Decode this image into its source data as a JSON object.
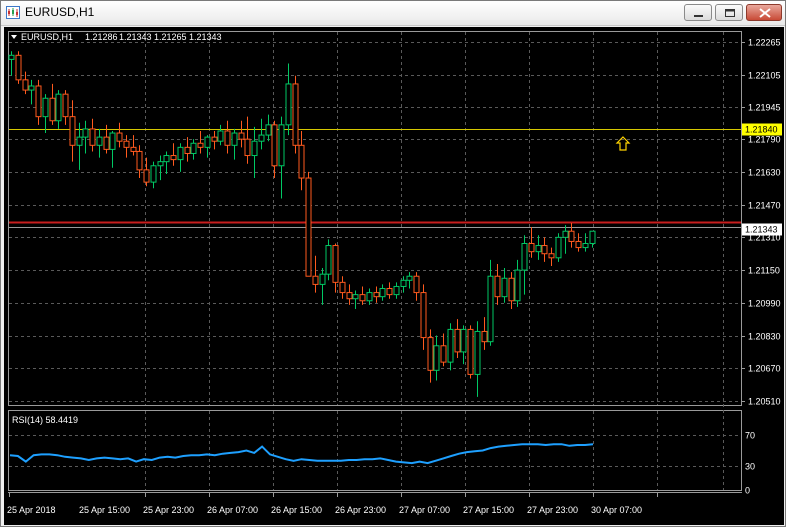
{
  "window": {
    "title": "EURUSD,H1"
  },
  "header": {
    "symbol": "EURUSD,H1",
    "open": "1.21286",
    "high": "1.21343",
    "low": "1.21265",
    "close": "1.21343"
  },
  "price_axis": {
    "labels": [
      "1.22265",
      "1.22105",
      "1.21945",
      "1.21790",
      "1.21630",
      "1.21470",
      "1.21310",
      "1.21150",
      "1.20990",
      "1.20830",
      "1.20670",
      "1.20510"
    ],
    "ask_line_label": "1.21840",
    "bid_line_label": "1.21343"
  },
  "time_axis": {
    "labels": [
      "25 Apr 2018",
      "25 Apr 15:00",
      "25 Apr 23:00",
      "26 Apr 07:00",
      "26 Apr 15:00",
      "26 Apr 23:00",
      "27 Apr 07:00",
      "27 Apr 15:00",
      "27 Apr 23:00",
      "30 Apr 07:00"
    ]
  },
  "rsi": {
    "label": "RSI(14) 58.4419",
    "levels": [
      "70",
      "30",
      "0"
    ],
    "level_values": [
      70,
      30,
      0
    ]
  },
  "colors": {
    "background": "#000000",
    "grid": "#5a5a5a",
    "bull_candle": "#00c864",
    "bear_candle": "#ff5a1e",
    "yellow_line": "#d6c800",
    "red_line": "#c81e1e",
    "rsi_line": "#1ea0ff"
  },
  "icons": {
    "arrow_marker": "up-arrow-icon",
    "window_minimize": "minimize-icon",
    "window_maximize": "maximize-icon",
    "window_close": "close-icon"
  },
  "chart_data": {
    "type": "candlestick",
    "symbol": "EURUSD",
    "timeframe": "H1",
    "ylim": [
      1.2051,
      1.22265
    ],
    "horizontal_lines": [
      1.2184,
      1.2138
    ],
    "arrow_price": 1.2177,
    "series": [
      {
        "name": "EURUSD,H1",
        "candles": [
          [
            1.2218,
            1.2222,
            1.221,
            1.222
          ],
          [
            1.222,
            1.2222,
            1.2206,
            1.2208
          ],
          [
            1.2208,
            1.2212,
            1.2201,
            1.2203
          ],
          [
            1.2203,
            1.2208,
            1.2196,
            1.2205
          ],
          [
            1.2205,
            1.2208,
            1.2186,
            1.219
          ],
          [
            1.219,
            1.2201,
            1.2182,
            1.2199
          ],
          [
            1.2199,
            1.2206,
            1.2186,
            1.2188
          ],
          [
            1.2188,
            1.2203,
            1.2184,
            1.2201
          ],
          [
            1.2201,
            1.2203,
            1.2186,
            1.219
          ],
          [
            1.219,
            1.2198,
            1.2168,
            1.2176
          ],
          [
            1.2176,
            1.2187,
            1.2164,
            1.218
          ],
          [
            1.218,
            1.2188,
            1.2172,
            1.2184
          ],
          [
            1.2184,
            1.2189,
            1.2173,
            1.2176
          ],
          [
            1.2176,
            1.2184,
            1.217,
            1.218
          ],
          [
            1.218,
            1.2186,
            1.2172,
            1.2174
          ],
          [
            1.2174,
            1.2183,
            1.2165,
            1.2182
          ],
          [
            1.2182,
            1.2187,
            1.2175,
            1.2178
          ],
          [
            1.2178,
            1.2181,
            1.217,
            1.2175
          ],
          [
            1.2175,
            1.2181,
            1.2171,
            1.2173
          ],
          [
            1.2173,
            1.2176,
            1.216,
            1.2164
          ],
          [
            1.2164,
            1.217,
            1.2156,
            1.2158
          ],
          [
            1.2158,
            1.2168,
            1.2155,
            1.2166
          ],
          [
            1.2166,
            1.2171,
            1.2159,
            1.2168
          ],
          [
            1.2168,
            1.2173,
            1.2162,
            1.2171
          ],
          [
            1.2171,
            1.2177,
            1.2166,
            1.2169
          ],
          [
            1.2169,
            1.2177,
            1.2163,
            1.2175
          ],
          [
            1.2175,
            1.218,
            1.2168,
            1.2172
          ],
          [
            1.2172,
            1.2179,
            1.2169,
            1.2177
          ],
          [
            1.2177,
            1.2183,
            1.2172,
            1.2175
          ],
          [
            1.2175,
            1.2181,
            1.217,
            1.218
          ],
          [
            1.218,
            1.2183,
            1.2174,
            1.2178
          ],
          [
            1.2178,
            1.2186,
            1.2176,
            1.2183
          ],
          [
            1.2183,
            1.2188,
            1.2172,
            1.2176
          ],
          [
            1.2176,
            1.2184,
            1.2169,
            1.2182
          ],
          [
            1.2182,
            1.2188,
            1.2175,
            1.2179
          ],
          [
            1.2179,
            1.219,
            1.2167,
            1.2171
          ],
          [
            1.2171,
            1.2185,
            1.216,
            1.2178
          ],
          [
            1.2178,
            1.2189,
            1.2174,
            1.2181
          ],
          [
            1.2181,
            1.2191,
            1.2178,
            1.2186
          ],
          [
            1.2186,
            1.2188,
            1.216,
            1.2166
          ],
          [
            1.2166,
            1.219,
            1.215,
            1.2186
          ],
          [
            1.2186,
            1.2216,
            1.2181,
            1.2206
          ],
          [
            1.2206,
            1.221,
            1.2172,
            1.2176
          ],
          [
            1.2176,
            1.2183,
            1.2154,
            1.216
          ],
          [
            1.216,
            1.2163,
            1.214,
            1.2112
          ],
          [
            1.2112,
            1.2122,
            1.2104,
            1.2108
          ],
          [
            1.2108,
            1.2116,
            1.2098,
            1.2113
          ],
          [
            1.2113,
            1.213,
            1.211,
            1.2127
          ],
          [
            1.2127,
            1.2128,
            1.2104,
            1.2109
          ],
          [
            1.2109,
            1.2112,
            1.2101,
            1.2104
          ],
          [
            1.2104,
            1.2108,
            1.2098,
            1.2101
          ],
          [
            1.2101,
            1.2105,
            1.2096,
            1.2103
          ],
          [
            1.2103,
            1.2107,
            1.2098,
            1.21
          ],
          [
            1.21,
            1.2106,
            1.2098,
            1.2104
          ],
          [
            1.2104,
            1.2107,
            1.2099,
            1.2102
          ],
          [
            1.2102,
            1.2108,
            1.21,
            1.2106
          ],
          [
            1.2106,
            1.2109,
            1.2101,
            1.2103
          ],
          [
            1.2103,
            1.2109,
            1.2101,
            1.2107
          ],
          [
            1.2107,
            1.2112,
            1.2104,
            1.211
          ],
          [
            1.211,
            1.2114,
            1.2106,
            1.2112
          ],
          [
            1.2112,
            1.2114,
            1.21,
            1.2104
          ],
          [
            1.2104,
            1.2108,
            1.2076,
            1.2082
          ],
          [
            1.2082,
            1.2086,
            1.206,
            1.2066
          ],
          [
            1.2066,
            1.2083,
            1.2061,
            1.2078
          ],
          [
            1.2078,
            1.2084,
            1.2068,
            1.207
          ],
          [
            1.207,
            1.2089,
            1.2066,
            1.2086
          ],
          [
            1.2086,
            1.2091,
            1.2072,
            1.2075
          ],
          [
            1.2075,
            1.2088,
            1.2069,
            1.2086
          ],
          [
            1.2086,
            1.2088,
            1.2062,
            1.2064
          ],
          [
            1.2064,
            1.209,
            1.2053,
            1.2085
          ],
          [
            1.2085,
            1.2092,
            1.2076,
            1.208
          ],
          [
            1.208,
            1.212,
            1.2078,
            1.2112
          ],
          [
            1.2112,
            1.2118,
            1.2098,
            1.2102
          ],
          [
            1.2102,
            1.2116,
            1.2099,
            1.2111
          ],
          [
            1.2111,
            1.2114,
            1.2096,
            1.21
          ],
          [
            1.21,
            1.212,
            1.2097,
            1.2115
          ],
          [
            1.2115,
            1.2132,
            1.2103,
            1.2128
          ],
          [
            1.2128,
            1.2136,
            1.2121,
            1.2124
          ],
          [
            1.2124,
            1.2132,
            1.212,
            1.2127
          ],
          [
            1.2127,
            1.2131,
            1.2119,
            1.2123
          ],
          [
            1.2123,
            1.2126,
            1.2117,
            1.2121
          ],
          [
            1.2121,
            1.2133,
            1.2119,
            1.2131
          ],
          [
            1.2131,
            1.2137,
            1.2123,
            1.2134
          ],
          [
            1.2134,
            1.2138,
            1.2126,
            1.2129
          ],
          [
            1.2129,
            1.2133,
            1.2124,
            1.2126
          ],
          [
            1.2126,
            1.2133,
            1.2124,
            1.2128
          ],
          [
            1.2128,
            1.2134,
            1.2126,
            1.2134
          ]
        ]
      }
    ],
    "rsi_series": [
      {
        "name": "RSI(14)",
        "values": [
          44,
          43,
          36,
          44,
          45,
          45,
          44,
          42,
          41,
          40,
          38,
          40,
          41,
          40,
          39,
          40,
          36,
          39,
          38,
          41,
          42,
          41,
          43,
          44,
          44,
          45,
          44,
          46,
          47,
          48,
          50,
          47,
          55,
          45,
          42,
          39,
          37,
          39,
          38,
          37,
          37,
          37,
          37,
          38,
          38,
          39,
          39,
          40,
          38,
          36,
          35,
          34,
          36,
          34,
          37,
          40,
          43,
          46,
          48,
          49,
          50,
          53,
          55,
          56,
          57,
          58,
          58,
          58,
          57,
          58,
          58,
          56,
          57,
          57,
          58
        ]
      }
    ]
  }
}
